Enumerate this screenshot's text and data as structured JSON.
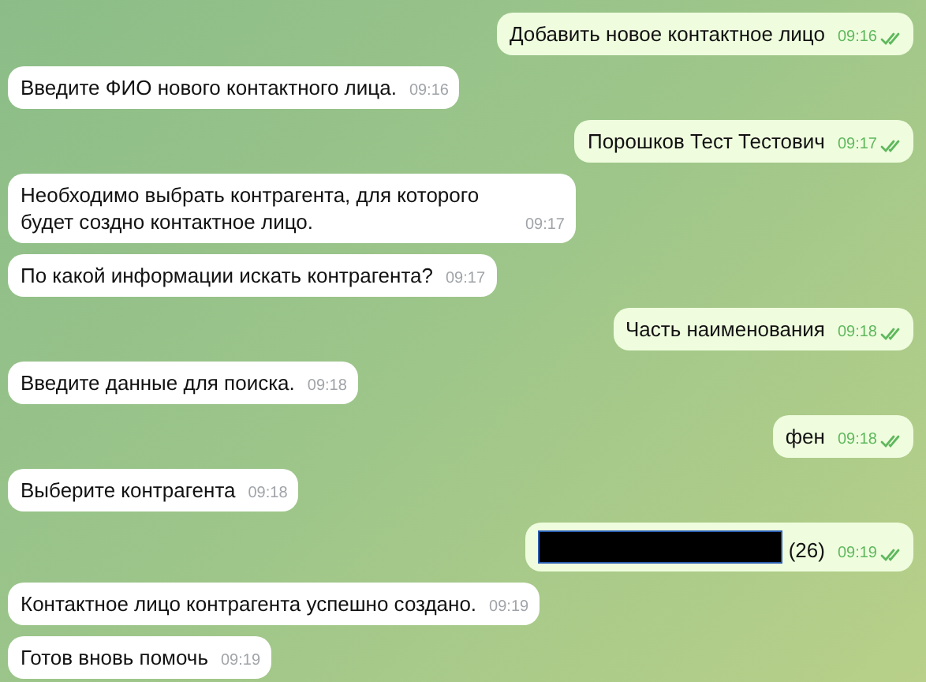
{
  "messages": [
    {
      "outgoing": true,
      "text": "Добавить новое контактное лицо",
      "time": "09:16",
      "read": true,
      "redacted": false
    },
    {
      "outgoing": false,
      "text": "Введите ФИО нового контактного лица.",
      "time": "09:16",
      "read": false,
      "redacted": false
    },
    {
      "outgoing": true,
      "text": "Порошков Тест Тестович",
      "time": "09:17",
      "read": true,
      "redacted": false
    },
    {
      "outgoing": false,
      "text": "Необходимо выбрать контрагента, для которого будет создно контактное лицо.",
      "time": "09:17",
      "read": false,
      "redacted": false
    },
    {
      "outgoing": false,
      "text": "По какой информации искать контрагента?",
      "time": "09:17",
      "read": false,
      "redacted": false
    },
    {
      "outgoing": true,
      "text": "Часть наименования",
      "time": "09:18",
      "read": true,
      "redacted": false
    },
    {
      "outgoing": false,
      "text": "Введите данные для поиска.",
      "time": "09:18",
      "read": false,
      "redacted": false
    },
    {
      "outgoing": true,
      "text": "фен",
      "time": "09:18",
      "read": true,
      "redacted": false
    },
    {
      "outgoing": false,
      "text": "Выберите контрагента",
      "time": "09:18",
      "read": false,
      "redacted": false
    },
    {
      "outgoing": true,
      "text": "(26)",
      "time": "09:19",
      "read": true,
      "redacted": true
    },
    {
      "outgoing": false,
      "text": "Контактное лицо контрагента успешно создано.",
      "time": "09:19",
      "read": false,
      "redacted": false
    },
    {
      "outgoing": false,
      "text": "Готов вновь помочь",
      "time": "09:19",
      "read": false,
      "redacted": false
    }
  ]
}
